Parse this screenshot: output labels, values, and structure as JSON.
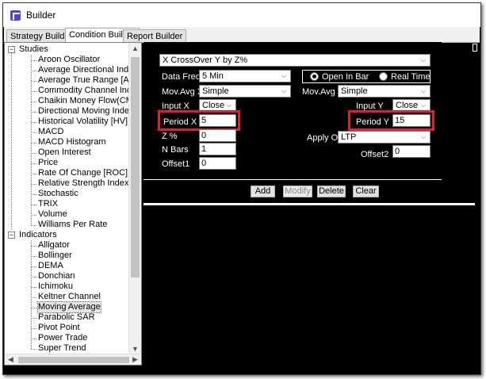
{
  "window": {
    "title": "Builder"
  },
  "tabs": [
    {
      "label": "Strategy Builder"
    },
    {
      "label": "Condition Builder"
    },
    {
      "label": "Report Builder"
    }
  ],
  "tree": {
    "groups": [
      {
        "label": "Studies",
        "items": [
          "Aroon Oscillator",
          "Average Directional Index [AD",
          "Average True Range [ATR]",
          "Commodity Channel Index [CC",
          "Chaikin Money Flow(CMF)",
          "Directional Moving Index [DMI",
          "Historical Volatility [HV]",
          "MACD",
          "MACD Histogram",
          "Open Interest",
          "Price",
          "Rate Of Change [ROC]",
          "Relative Strength Index [RSI]",
          "Stochastic",
          "TRIX",
          "Volume",
          "Williams Per Rate"
        ]
      },
      {
        "label": "Indicators",
        "items": [
          "Alligator",
          "Bollinger",
          "DEMA",
          "Donchian",
          "Ichimoku",
          "Keltner Channel",
          "Moving Average",
          "Parabolic SAR",
          "Pivot Point",
          "Power Trade",
          "Super Trend"
        ]
      }
    ],
    "selected": "Moving Average"
  },
  "form": {
    "condition": "X CrossOver Y by Z%",
    "data_freq_label": "Data Freq",
    "data_freq_value": "5 Min",
    "radio": {
      "open_in_bar": "Open In Bar",
      "real_time": "Real Time"
    },
    "mov_avg_x_label": "Mov.Avg X",
    "mov_avg_x_value": "Simple",
    "mov_avg_y_label": "Mov.Avg Y",
    "mov_avg_y_value": "Simple",
    "input_x_label": "Input X",
    "input_x_value": "Close",
    "input_y_label": "Input Y",
    "input_y_value": "Close",
    "period_x_label": "Period X",
    "period_x_value": "5",
    "period_y_label": "Period Y",
    "period_y_value": "15",
    "z_label": "Z %",
    "z_value": "0",
    "apply_on_label": "Apply On",
    "apply_on_value": "LTP",
    "nbars_label": "N Bars",
    "nbars_value": "1",
    "offset2_label": "Offset2",
    "offset2_value": "0",
    "offset1_label": "Offset1",
    "offset1_value": "0"
  },
  "buttons": {
    "add": "Add",
    "modify": "Modify",
    "delete": "Delete",
    "clear": "Clear"
  },
  "colors": {
    "highlight": "#d9232d",
    "panel_bg": "#000000"
  }
}
